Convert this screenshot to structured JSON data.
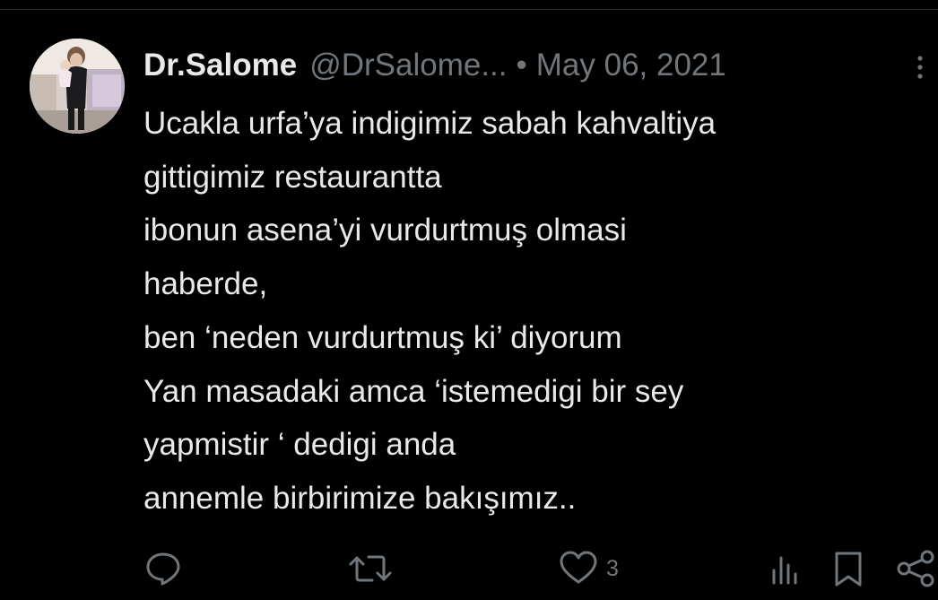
{
  "tweet": {
    "author_name": "Dr.Salome",
    "handle": "@DrSalome...",
    "separator": "•",
    "date": "May 06, 2021",
    "lines": [
      "Ucakla urfa’ya indigimiz sabah kahvaltiya",
      "gittigimiz restaurantta",
      "ibonun asena’yi vurdurtmuş olmasi",
      "haberde,",
      "ben ‘neden vurdurtmuş ki’ diyorum",
      "Yan masadaki amca ‘istemedigi bir sey",
      "yapmistir ‘ dedigi anda",
      "annemle birbirimize bakışımız.."
    ]
  },
  "actions": {
    "reply_icon": "reply-icon",
    "retweet_icon": "retweet-icon",
    "like_icon": "heart-icon",
    "like_count": "3",
    "views_icon": "views-icon",
    "bookmark_icon": "bookmark-icon",
    "share_icon": "share-icon"
  },
  "colors": {
    "background": "#000000",
    "primary_text": "#e7e9ea",
    "secondary_text": "#71767b",
    "divider": "#2f3336"
  }
}
